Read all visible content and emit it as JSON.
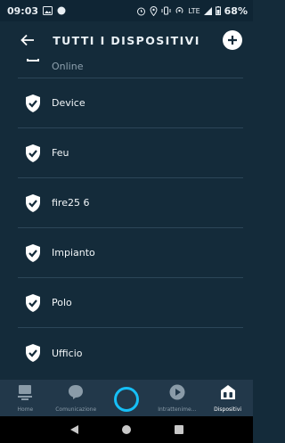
{
  "status_bar": {
    "time": "09:03",
    "network": "LTE",
    "battery": "68%"
  },
  "header": {
    "title": "TUTTI I DISPOSITIVI"
  },
  "devices": {
    "partial_label": "Online",
    "items": [
      {
        "label": "Device"
      },
      {
        "label": "Feu"
      },
      {
        "label": "fire25 6"
      },
      {
        "label": "Impianto"
      },
      {
        "label": "Polo"
      },
      {
        "label": "Ufficio"
      }
    ]
  },
  "bottom_nav": {
    "items": [
      {
        "label": "Home",
        "icon": "home-icon"
      },
      {
        "label": "Comunicazione",
        "icon": "chat-bubble-icon"
      },
      {
        "label": "",
        "icon": "alexa-ring-icon"
      },
      {
        "label": "Intrattenime...",
        "icon": "play-icon"
      },
      {
        "label": "Dispositivi",
        "icon": "devices-icon"
      }
    ],
    "active": "Dispositivi"
  },
  "colors": {
    "background": "#142b3a",
    "divider": "#2c4658",
    "nav_background": "#22384a",
    "accent": "#16bff6"
  }
}
